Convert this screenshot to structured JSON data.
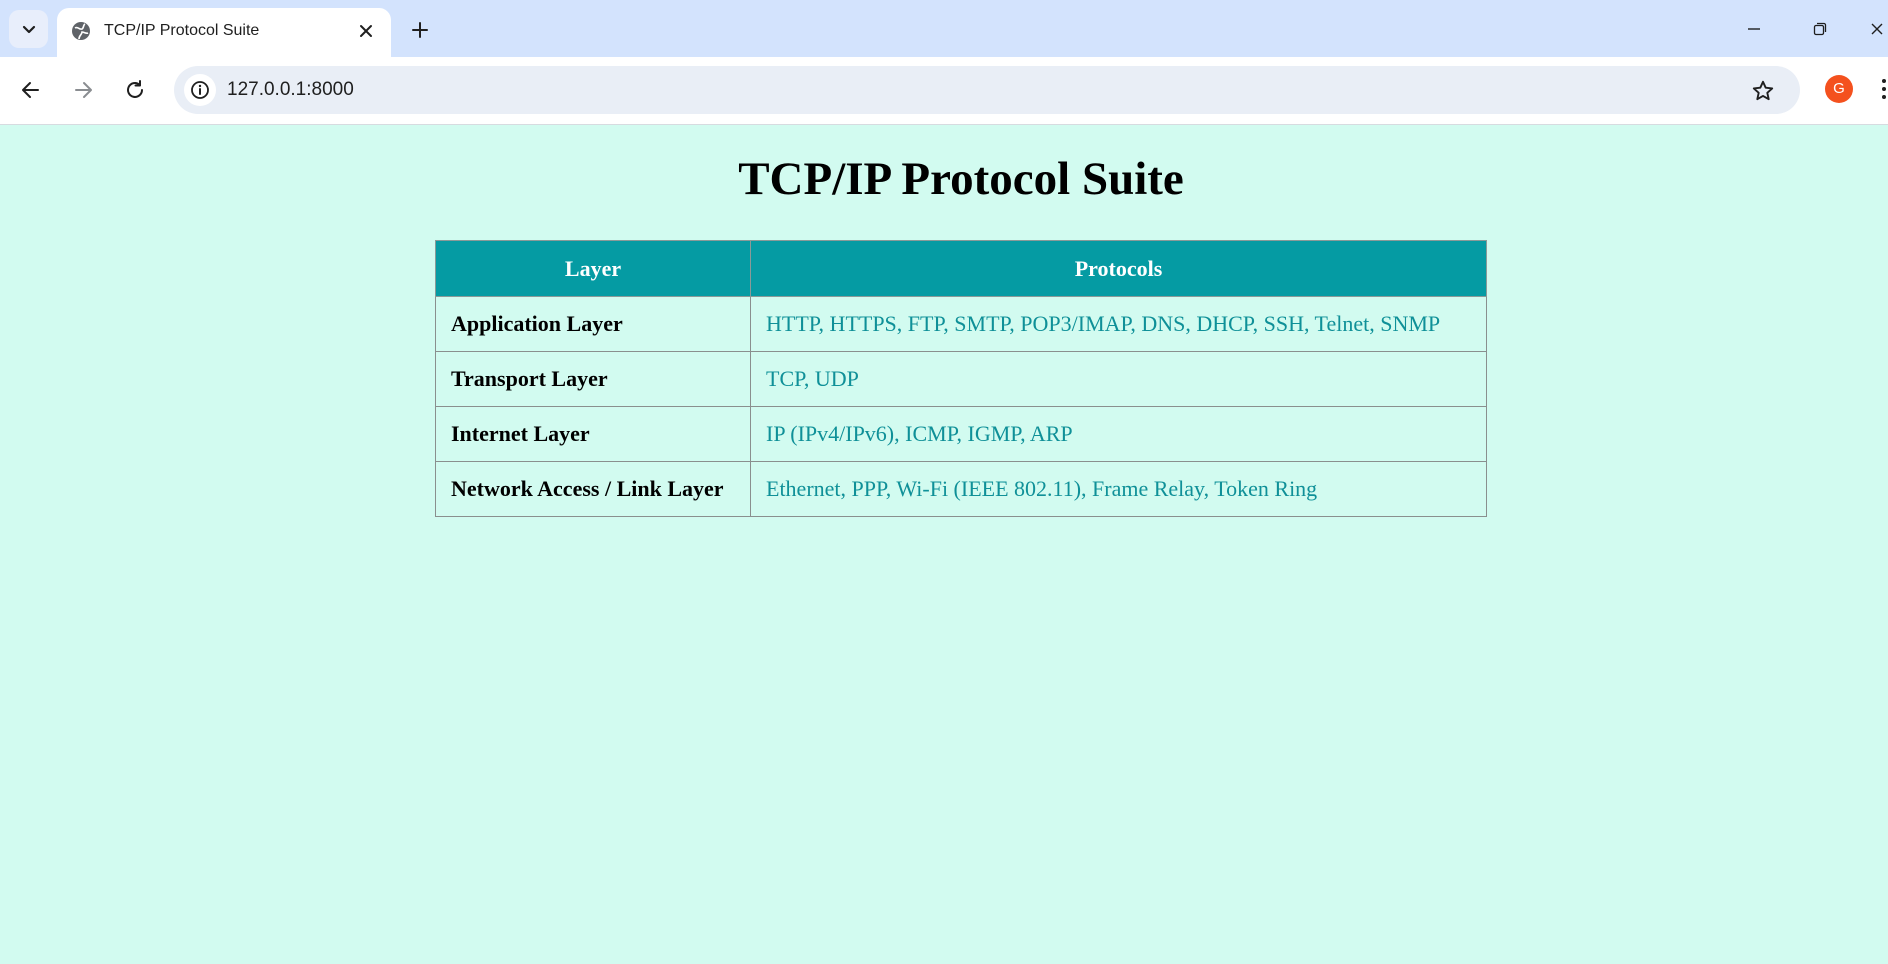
{
  "browser": {
    "tab": {
      "title": "TCP/IP Protocol Suite"
    },
    "address_bar": {
      "url": "127.0.0.1:8000"
    },
    "profile": {
      "initial": "G",
      "color": "#f4511e"
    },
    "icons": {
      "tab_list": "chevron-down-icon",
      "favicon": "globe-icon",
      "tab_close": "close-icon",
      "new_tab": "plus-icon",
      "minimize": "minimize-icon",
      "maximize": "restore-icon",
      "close_window": "close-icon",
      "back": "arrow-left-icon",
      "forward": "arrow-right-icon",
      "reload": "reload-icon",
      "site_info": "info-icon",
      "bookmark": "star-icon",
      "menu": "more-vertical-icon"
    }
  },
  "page": {
    "title": "TCP/IP Protocol Suite",
    "background": "#d2fbf0",
    "table": {
      "header_color": "#059ba3",
      "protocol_text_color": "#0f9098",
      "headers": [
        "Layer",
        "Protocols"
      ],
      "rows": [
        {
          "layer": "Application Layer",
          "protocols": "HTTP, HTTPS, FTP, SMTP, POP3/IMAP, DNS, DHCP, SSH, Telnet, SNMP"
        },
        {
          "layer": "Transport Layer",
          "protocols": "TCP, UDP"
        },
        {
          "layer": "Internet Layer",
          "protocols": "IP (IPv4/IPv6), ICMP, IGMP, ARP"
        },
        {
          "layer": "Network Access / Link Layer",
          "protocols": "Ethernet, PPP, Wi-Fi (IEEE 802.11), Frame Relay, Token Ring"
        }
      ]
    }
  }
}
